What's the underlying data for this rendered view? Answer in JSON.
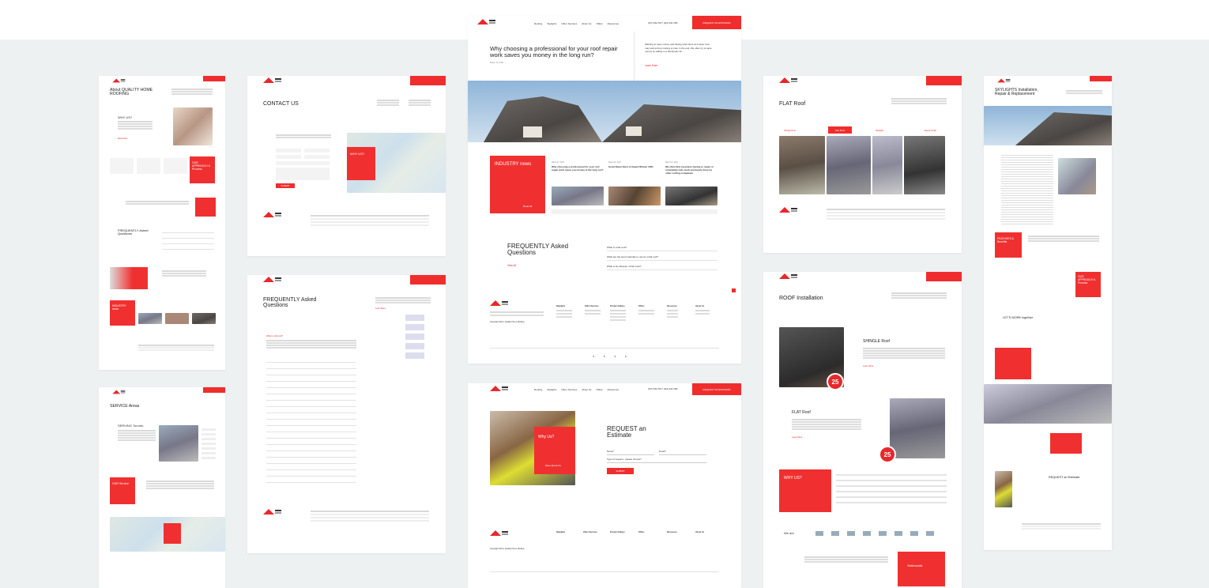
{
  "colors": {
    "accent": "#f02d2d",
    "background": "#eef1f2"
  },
  "nav": {
    "items": [
      "Roofing",
      "Skylights",
      "Other Services",
      "About Us",
      "Offers",
      "Resources"
    ],
    "phone": "(647) 699-7527  |  (416) 292-7383",
    "cta": "REQUEST AN ESTIMATE"
  },
  "center": {
    "title": "Why choosing a professional for your roof repair work saves you money in the long run?",
    "date": "March 10, 2021",
    "intro": "Wanting to save money and having work done at a lower cost, may well end up costing a more in the end. We often try to save money by calling in a handyman for ...",
    "learn_more": "Learn More",
    "news_label": "INDUSTRY news",
    "read_all": "Read All",
    "news": [
      {
        "date": "March 10, 2021",
        "title": "Why choosing a professional for your roof repair work saves you money in the long run?"
      },
      {
        "date": "March 10, 2021",
        "title": "Great News! Best of Award Winner 2021"
      },
      {
        "date": "March 10, 2021",
        "title": "We often find ourselves having to repair or completely redo work previously done by other roofing companies"
      }
    ],
    "faq_title": "FREQUENTLY Asked Questions",
    "view_all": "View All",
    "faq": [
      "What is a flat roof?",
      "What are the best materials to use for a flat roof?",
      "What is the lifespan of flat roofs?"
    ],
    "footer_cols": [
      "Skylights",
      "Other Services",
      "Product Gallery",
      "Offers",
      "Resources",
      "About Us"
    ],
    "copyright": "Copyright 2021 | Quality Home Roofing"
  },
  "estimate": {
    "title": "REQUEST an Estimate",
    "why": "Why Us?",
    "more_about": "More About Us",
    "name": "Name*",
    "email": "Email*",
    "type": "Type of request - please choose*",
    "submit": "SUBMIT"
  },
  "about": {
    "title": "About QUALITY HOME ROOFING",
    "why": "WHY US?",
    "read_more": "Read More",
    "approach": "OUR APPROACH & Process",
    "faq": "FREQUENTLY Asked Questions",
    "industry": "INDUSTRY news"
  },
  "contact": {
    "title": "CONTACT US",
    "submit": "SUBMIT",
    "why": "WHY US?"
  },
  "faqpage": {
    "title": "FREQUENTLY Asked Questions",
    "learn_more": "Learn More",
    "first": "What is a flat roof?"
  },
  "service": {
    "title": "SERVICE Areas",
    "serving": "SERVING Toronto",
    "our_service": "OUR Service"
  },
  "flat": {
    "title": "FLAT Roof",
    "tabs": [
      "Shingle Roof",
      "Flat Roof",
      "Skylights",
      "Eaves & Flat"
    ]
  },
  "install": {
    "title": "ROOF Installation",
    "shingle": "SHINGLE Roof",
    "flat": "FLAT Roof",
    "learn_more": "Learn More",
    "badge": "25",
    "why": "WHY US?",
    "we_are": "We are",
    "testimonials": "Testimonials"
  },
  "skylights": {
    "title": "SKYLIGHTS Installation, Repair & Replacement",
    "features": "FEATURES & Benefits",
    "approach": "OUR APPROACH & Process",
    "together": "LET'S WORK together",
    "request": "REQUEST an Estimate"
  }
}
